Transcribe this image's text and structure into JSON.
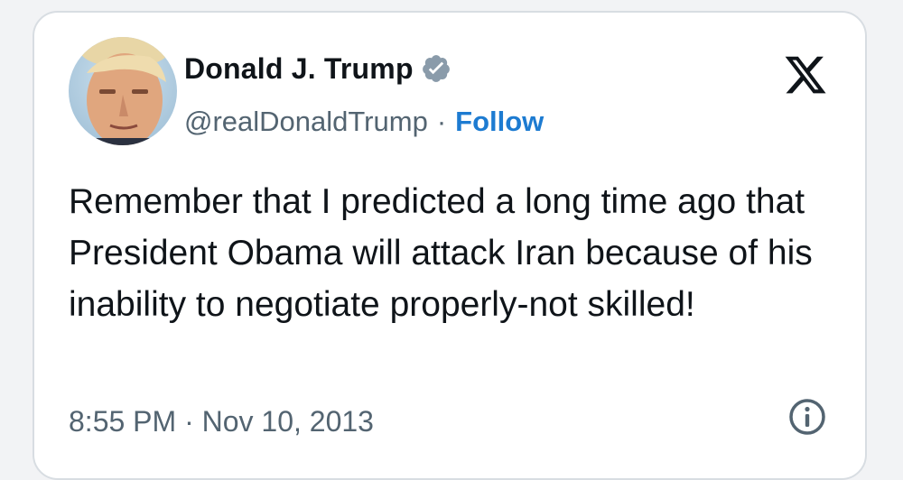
{
  "author": {
    "display_name": "Donald J. Trump",
    "handle": "@realDonaldTrump",
    "verified_icon": "verified-badge-icon"
  },
  "separator": "·",
  "follow_label": "Follow",
  "platform_icon": "x-logo-icon",
  "tweet": {
    "text": "Remember that I predicted a long time ago that President Obama will attack Iran because of his inability to negotiate properly-not skilled!",
    "timestamp": "8:55 PM · Nov 10, 2013"
  },
  "info_icon": "info-icon",
  "colors": {
    "text": "#0f1419",
    "secondary": "#536471",
    "link": "#1d7bd1",
    "verified_badge": "#8a9baa",
    "border": "#d8dde2"
  }
}
